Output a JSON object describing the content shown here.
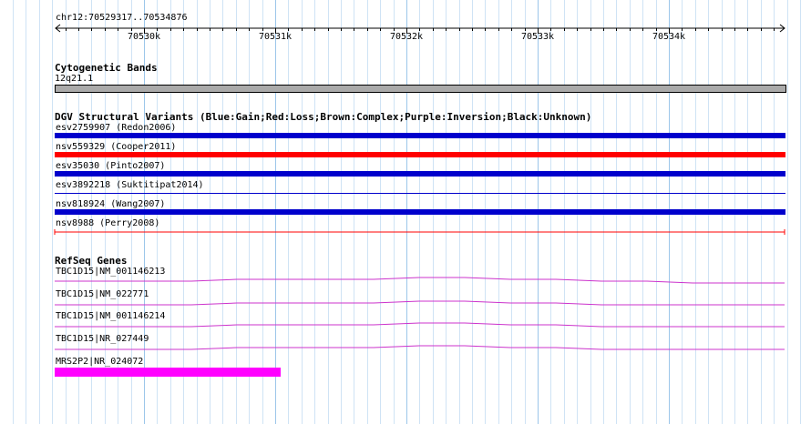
{
  "ruler": {
    "region": "chr12:70529317..70534876",
    "ticks": [
      "70530k",
      "70531k",
      "70532k",
      "70533k",
      "70534k"
    ]
  },
  "cytoband": {
    "title": "Cytogenetic Bands",
    "band": "12q21.1",
    "color": "#aaaaaa"
  },
  "dgv": {
    "title": "DGV Structural Variants (Blue:Gain;Red:Loss;Brown:Complex;Purple:Inversion;Black:Unknown)",
    "variants": [
      {
        "label": "esv2759907 (Redon2006)",
        "type": "gain",
        "color": "#0000cc"
      },
      {
        "label": "nsv559329 (Cooper2011)",
        "type": "loss",
        "color": "#ff0000"
      },
      {
        "label": "esv35030 (Pinto2007)",
        "type": "gain",
        "color": "#0000cc"
      },
      {
        "label": "esv3892218 (Suktitipat2014)",
        "type": "gain",
        "color": "#0000cc"
      },
      {
        "label": "nsv818924 (Wang2007)",
        "type": "gain",
        "color": "#0000cc"
      },
      {
        "label": "nsv8988 (Perry2008)",
        "type": "loss",
        "color": "#ff0000"
      }
    ]
  },
  "refseq": {
    "title": "RefSeq Genes",
    "genes": [
      {
        "label": "TBC1D15|NM_001146213",
        "color": "#cc33cc"
      },
      {
        "label": "TBC1D15|NM_022771",
        "color": "#cc33cc"
      },
      {
        "label": "TBC1D15|NM_001146214",
        "color": "#cc33cc"
      },
      {
        "label": "TBC1D15|NR_027449",
        "color": "#cc33cc"
      },
      {
        "label": "MRS2P2|NR_024072",
        "color": "#ff00ff"
      }
    ]
  }
}
